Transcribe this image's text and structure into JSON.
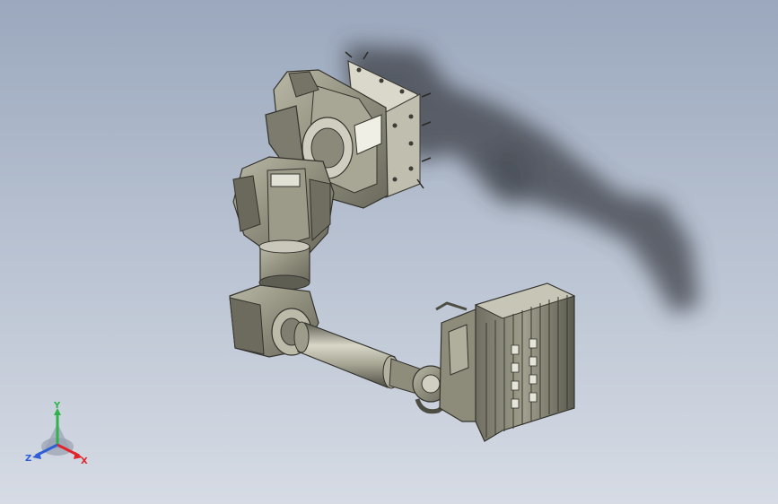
{
  "triad": {
    "x_label": "X",
    "y_label": "Y",
    "z_label": "Z"
  },
  "colors": {
    "background_top": "#9ba8bd",
    "background_bottom": "#d6dbe4",
    "model_body": "#8f8e7d",
    "model_light": "#b9b8a6",
    "model_dark": "#55544a",
    "shadow": "#3c4046",
    "axis_x": "#e0242a",
    "axis_y": "#2fb34a",
    "axis_z": "#2e5fd6"
  },
  "icons": {
    "triad": "coordinate-triad-icon"
  }
}
